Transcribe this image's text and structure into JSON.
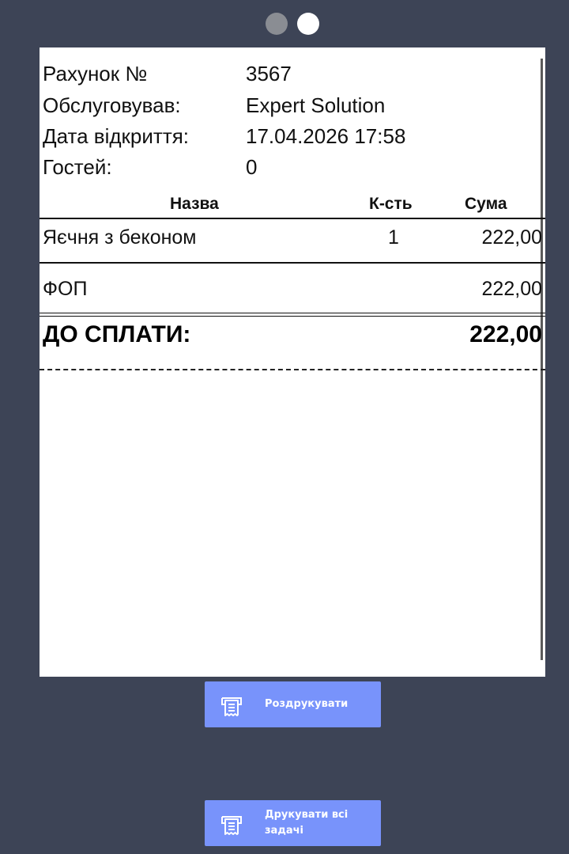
{
  "pager": {
    "total": 2,
    "active_index": 1
  },
  "receipt": {
    "info": {
      "check_label": "Рахунок №",
      "check_value": "3567",
      "waiter_label": "Обслуговував:",
      "waiter_value": "Expert Solution",
      "opened_label": "Дата відкриття:",
      "opened_value": "17.04.2026 17:58",
      "guests_label": "Гостей:",
      "guests_value": "0"
    },
    "columns": {
      "name": "Назва",
      "qty": "К-сть",
      "sum": "Сума"
    },
    "items": [
      {
        "name": "Яєчня з беконом",
        "qty": "1",
        "sum": "222,00"
      }
    ],
    "subtotal": {
      "label": "ФОП",
      "value": "222,00"
    },
    "total": {
      "label": "ДО СПЛАТИ:",
      "value": "222,00"
    }
  },
  "buttons": {
    "print_label": "Роздрукувати",
    "print_all_label": "Друкувати всі задачі"
  },
  "colors": {
    "background": "#3d4456",
    "button": "#7893fb",
    "paper": "#ffffff"
  }
}
